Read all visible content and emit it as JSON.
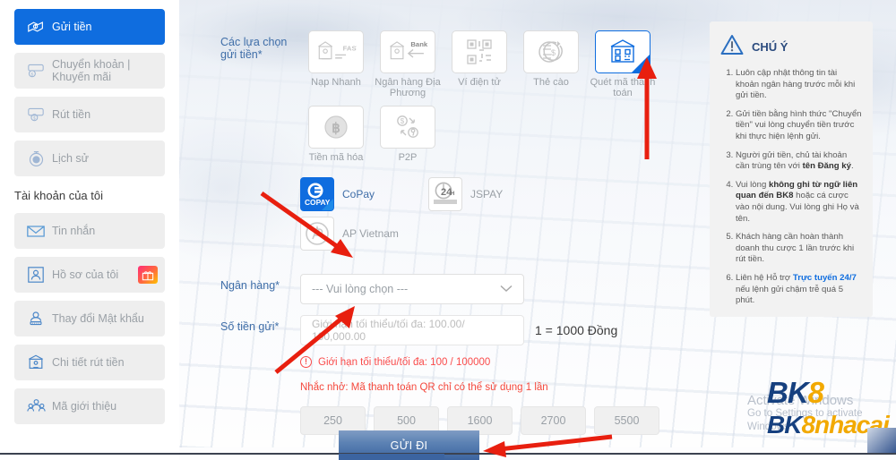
{
  "sidebar": {
    "items": [
      {
        "label": "Gửi tiền",
        "icon": "deposit-hand-icon",
        "active": true
      },
      {
        "label": "Chuyển khoản | Khuyến mãi",
        "icon": "transfer-icon",
        "active": false
      },
      {
        "label": "Rút tiền",
        "icon": "withdraw-icon",
        "active": false
      },
      {
        "label": "Lịch sử",
        "icon": "history-clock-icon",
        "active": false
      }
    ],
    "account_heading": "Tài khoản của tôi",
    "account_items": [
      {
        "label": "Tin nhắn",
        "icon": "envelope-icon",
        "badge": false
      },
      {
        "label": "Hồ sơ của tôi",
        "icon": "profile-card-icon",
        "badge": true
      },
      {
        "label": "Thay đổi Mật khẩu",
        "icon": "password-user-icon",
        "badge": false
      },
      {
        "label": "Chi tiết rút tiền",
        "icon": "bank-detail-icon",
        "badge": false
      },
      {
        "label": "Mã giới thiệu",
        "icon": "referral-people-icon",
        "badge": false
      }
    ]
  },
  "form": {
    "deposit_options_label": "Các lựa chọn gửi tiền*",
    "options": [
      {
        "label": "Nạp Nhanh",
        "icon": "fast-bank-icon",
        "selected": false
      },
      {
        "label": "Ngân hàng Địa Phương",
        "icon": "local-bank-icon",
        "selected": false
      },
      {
        "label": "Ví điện tử",
        "icon": "qr-wallet-icon",
        "selected": false
      },
      {
        "label": "Thẻ cào",
        "icon": "scratch-card-icon",
        "selected": false
      },
      {
        "label": "Quét mã thanh toán",
        "icon": "qr-scan-pay-icon",
        "selected": true
      },
      {
        "label": "Tiền mã hóa",
        "icon": "bitcoin-icon",
        "selected": false
      },
      {
        "label": "P2P",
        "icon": "p2p-exchange-icon",
        "selected": false
      }
    ],
    "providers": [
      {
        "name": "CoPay",
        "icon": "copay-logo-icon",
        "selected": true
      },
      {
        "name": "JSPAY",
        "icon": "jspay-logo-icon",
        "selected": false
      },
      {
        "name": "AP Vietnam",
        "icon": "ap-vietnam-logo-icon",
        "selected": false
      }
    ],
    "bank_label": "Ngân hàng*",
    "bank_select_value": "--- Vui lòng chọn ---",
    "amount_label": "Số tiền gửi*",
    "amount_value": "",
    "amount_placeholder": "Giới hạn tối thiểu/tối đa: 100.00/ 100,000.00",
    "rate_text": "1 = 1000 Đồng",
    "error_text": "Giới hạn tối thiểu/tối đa: 100 / 100000",
    "reminder_text": "Nhắc nhở: Mã thanh toán QR chỉ có thể sử dụng 1 lần",
    "quick_amounts": [
      "250",
      "500",
      "1600",
      "2700",
      "5500"
    ],
    "submit_label": "GỬI ĐI"
  },
  "notice": {
    "title": "CHÚ Ý",
    "icon": "warning-triangle-icon",
    "items": [
      {
        "plain": "Luôn cập nhật thông tin tài khoản ngân hàng trước mỗi khi gửi tiền."
      },
      {
        "plain": "Gửi tiền bằng hình thức \"Chuyển tiền\" vui lòng chuyển tiền trước khi thực hiện lệnh gửi."
      },
      {
        "pre": "Người gửi tiền, chủ tài khoản cần trùng tên với ",
        "strong": "tên Đăng ký",
        "post": "."
      },
      {
        "pre": "Vui lòng ",
        "strong": "không ghi từ ngữ liên quan đến BK8",
        "post": " hoặc cá cược vào nội dung. Vui lòng ghi Họ và tên."
      },
      {
        "plain": "Khách hàng cần hoàn thành doanh thu cược 1 lần trước khi rút tiền."
      },
      {
        "pre": "Liên hệ Hỗ trợ ",
        "link": "Trực tuyến 24/7",
        "post": " nếu lệnh gửi chậm trễ quá 5 phút."
      }
    ]
  },
  "watermark": {
    "line1": "Activate Windows",
    "line2": "Go to Settings to activate Windows"
  },
  "logo": {
    "top_blue": "BK",
    "top_yellow": "8",
    "bottom_blue": "BK",
    "bottom_yellow": "8nhacai"
  },
  "colors": {
    "accent_blue": "#0f6ddf",
    "label_blue": "#3f6ea8",
    "error_red": "#fa4b4b",
    "arrow_red": "#e81f0f",
    "logo_blue": "#16407f",
    "logo_yellow": "#f2a900"
  }
}
